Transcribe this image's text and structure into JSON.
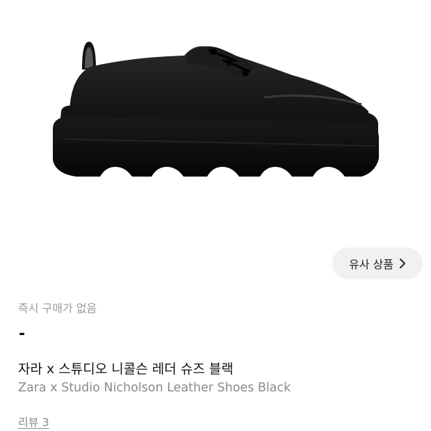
{
  "product": {
    "similar_button_label": "유사 상품",
    "status_text": "즉시 구매가 없음",
    "price": "-",
    "title_ko": "자라 x 스튜디오 니콜슨 레더 슈즈 블랙",
    "title_en": "Zara x Studio Nicholson Leather Shoes Black",
    "review_link": "리뷰 3"
  },
  "colors": {
    "background": "#ffffff",
    "button_bg": "#f1f1f3",
    "muted_text": "#8a8a8a",
    "primary_text": "#111111"
  }
}
